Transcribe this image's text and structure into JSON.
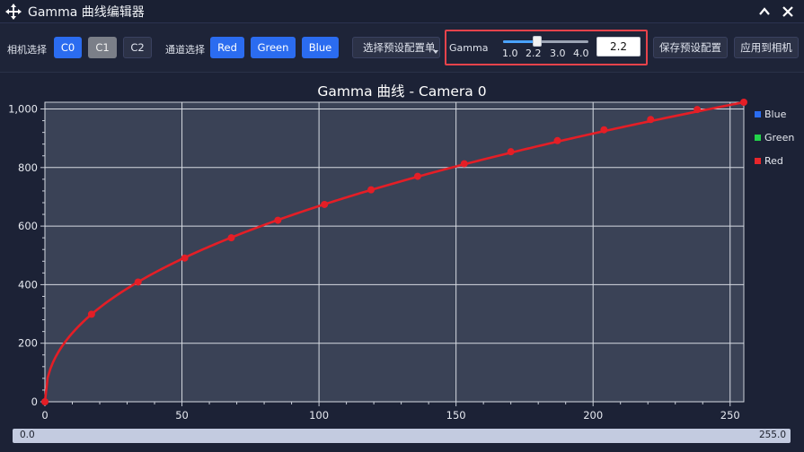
{
  "window": {
    "title": "Gamma 曲线编辑器"
  },
  "toolbar": {
    "camera_label": "相机选择",
    "cameras": [
      "C0",
      "C1",
      "C2"
    ],
    "selected_camera": "C1",
    "channel_label": "通道选择",
    "channels": [
      "Red",
      "Green",
      "Blue"
    ],
    "preset_select": "选择预设配置单",
    "gamma_label": "Gamma",
    "gamma_ticks": [
      "1.0",
      "2.2",
      "3.0",
      "4.0"
    ],
    "gamma_value": "2.2",
    "gamma_slider_fraction": 0.4,
    "save_preset": "保存预设配置",
    "apply_camera": "应用到相机"
  },
  "chart_data": {
    "type": "line",
    "title": "Gamma 曲线 - Camera 0",
    "xlabel": "",
    "ylabel": "",
    "xlim": [
      0,
      255
    ],
    "ylim": [
      0,
      1023
    ],
    "x_ticks": [
      "0",
      "50",
      "100",
      "150",
      "200",
      "250"
    ],
    "y_ticks": [
      "0",
      "200",
      "400",
      "600",
      "800",
      "1,000"
    ],
    "grid": true,
    "legend": {
      "position": "right",
      "items": [
        {
          "name": "Blue",
          "color": "#2a6cf0"
        },
        {
          "name": "Green",
          "color": "#22d34a"
        },
        {
          "name": "Red",
          "color": "#e8262b"
        }
      ]
    },
    "series": [
      {
        "name": "Red",
        "color": "#e41e26",
        "gamma": 2.2,
        "points_x": [
          0,
          17,
          34,
          51,
          68,
          85,
          102,
          119,
          136,
          153,
          170,
          187,
          204,
          221,
          238,
          255
        ],
        "points_y": [
          0,
          299,
          409,
          491,
          560,
          620,
          674,
          724,
          770,
          813,
          854,
          892,
          929,
          964,
          998,
          1023
        ]
      }
    ]
  },
  "bottom_bar": {
    "left_value": "0.0",
    "right_value": "255.0"
  },
  "colors": {
    "background": "#1c2236",
    "plot_bg": "#3a4256",
    "accent": "#2b6cf0",
    "highlight_box": "#e8434b"
  }
}
